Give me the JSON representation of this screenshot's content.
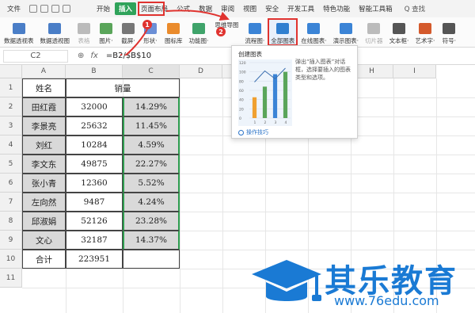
{
  "menubar": {
    "file": "文件",
    "tabs": [
      "开始",
      "插入",
      "页面布局",
      "公式",
      "数据",
      "审阅",
      "视图",
      "安全",
      "开发工具",
      "特色功能",
      "智能工具箱"
    ],
    "active_tab": "插入",
    "search": "Q 查找"
  },
  "ribbon": {
    "items": [
      {
        "label": "数据透视表",
        "color": "#4a7ec7"
      },
      {
        "label": "数据透视图",
        "color": "#4a7ec7"
      },
      {
        "label": "表格",
        "color": "#bbbbbb"
      },
      {
        "label": "图片·",
        "color": "#5aa55a"
      },
      {
        "label": "截屏·",
        "color": "#777777"
      },
      {
        "label": "形状·",
        "color": "#6b8fd6"
      },
      {
        "label": "图标库",
        "color": "#ea8b2c"
      },
      {
        "label": "功能图·",
        "color": "#3fa36a"
      },
      {
        "label": "流程图·",
        "color": "#3b84d6"
      },
      {
        "label": "全部图表",
        "color": "#2f7fd0"
      },
      {
        "label": "在线图表·",
        "color": "#3b84d6"
      },
      {
        "label": "演示图表·",
        "color": "#3b84d6"
      },
      {
        "label": "切片器",
        "color": "#bbbbbb"
      },
      {
        "label": "文本框·",
        "color": "#555555"
      },
      {
        "label": "艺术字·",
        "color": "#d45a2c"
      },
      {
        "label": "符号·",
        "color": "#555555"
      }
    ],
    "small_item": "思维导图"
  },
  "formula": {
    "cell_ref": "C2",
    "fx": "fx",
    "content": "=B2/$B$10"
  },
  "sheet": {
    "columns": [
      "A",
      "B",
      "C",
      "D",
      "E",
      "F",
      "G",
      "H",
      "I"
    ],
    "rows": [
      "1",
      "2",
      "3",
      "4",
      "5",
      "6",
      "7",
      "8",
      "9",
      "10",
      "11"
    ],
    "header_name": "姓名",
    "header_sales": "销量",
    "data": [
      {
        "name": "田红霞",
        "sales": "32000",
        "pct": "14.29%"
      },
      {
        "name": "李景亮",
        "sales": "25632",
        "pct": "11.45%"
      },
      {
        "name": "刘红",
        "sales": "10284",
        "pct": "4.59%"
      },
      {
        "name": "李文东",
        "sales": "49875",
        "pct": "22.27%"
      },
      {
        "name": "张小青",
        "sales": "12360",
        "pct": "5.52%"
      },
      {
        "name": "左向然",
        "sales": "9487",
        "pct": "4.24%"
      },
      {
        "name": "邱淑娟",
        "sales": "52126",
        "pct": "23.28%"
      },
      {
        "name": "文心",
        "sales": "32187",
        "pct": "14.37%"
      }
    ],
    "total_label": "合计",
    "total_value": "223951"
  },
  "popup": {
    "title": "创建图表",
    "description": "弹出“插入图表”对话框，选择要插入的图表类型和选项。",
    "help": "操作技巧",
    "preview": {
      "y_ticks": [
        "120",
        "100",
        "80",
        "60",
        "40",
        "20",
        "0"
      ],
      "x_ticks": [
        "1",
        "2",
        "3",
        "4"
      ],
      "bars": [
        {
          "value": 45,
          "color": "#f0a030"
        },
        {
          "value": 68,
          "color": "#5aa55a"
        },
        {
          "value": 95,
          "color": "#3b84d6"
        },
        {
          "value": 100,
          "color": "#5aa55a"
        }
      ],
      "line_values": [
        78,
        102,
        85,
        108
      ]
    }
  },
  "steps": {
    "one": "1",
    "two": "2"
  },
  "watermark": {
    "title": "其乐教育",
    "url": "www.76edu.com"
  }
}
